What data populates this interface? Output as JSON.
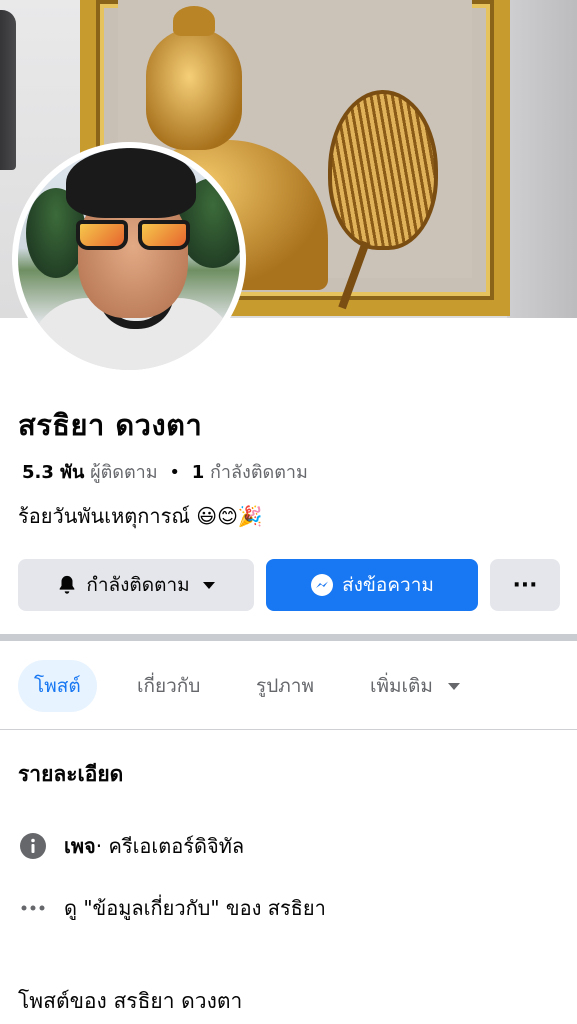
{
  "profile": {
    "name": "สรธิยา ดวงตา",
    "followers_count": "5.3 พัน",
    "followers_label": "ผู้ติดตาม",
    "separator": "•",
    "following_count": "1",
    "following_label": "กำลังติดตาม",
    "bio": "ร้อยวันพันเหตุการณ์ 😃😊🎉"
  },
  "actions": {
    "follow_label": "กำลังติดตาม",
    "message_label": "ส่งข้อความ",
    "more_label": "···"
  },
  "tabs": [
    {
      "label": "โพสต์"
    },
    {
      "label": "เกี่ยวกับ"
    },
    {
      "label": "รูปภาพ"
    },
    {
      "label": "เพิ่มเติม"
    }
  ],
  "details": {
    "title": "รายละเอียด",
    "page_bold": "เพจ",
    "page_rest": " · ครีเอเตอร์ดิจิทัล",
    "about_link": "ดู \"ข้อมูลเกี่ยวกับ\" ของ สรธิยา"
  },
  "posts_title": "โพสต์ของ สรธิยา ดวงตา",
  "colors": {
    "accent": "#1877f2",
    "button_gray": "#e4e6eb",
    "muted_text": "#65676b",
    "tab_active_bg": "#e7f3ff"
  },
  "icons": {
    "follow": "bell-icon",
    "message": "messenger-icon",
    "more": "more-icon",
    "tab_more": "caret-down-icon",
    "page_info": "info-icon",
    "about": "ellipsis-icon"
  }
}
